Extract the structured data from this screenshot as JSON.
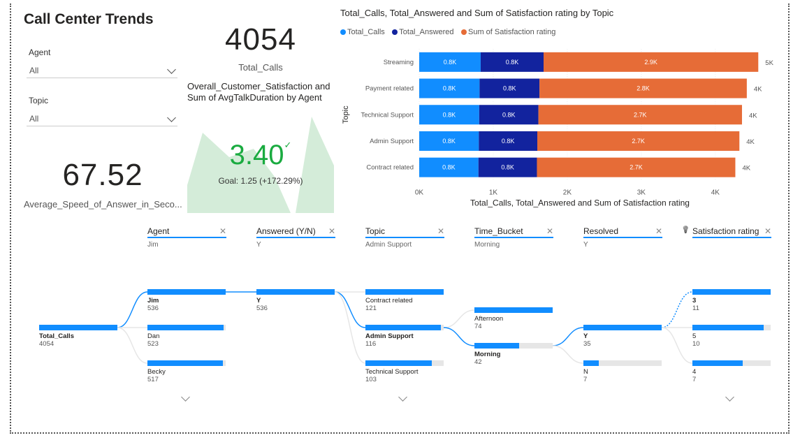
{
  "title": "Call Center Trends",
  "slicers": [
    {
      "label": "Agent",
      "value": "All"
    },
    {
      "label": "Topic",
      "value": "All"
    }
  ],
  "total_calls_card": {
    "value": "4054",
    "label": "Total_Calls"
  },
  "asa_card": {
    "value": "67.52",
    "label": "Average_Speed_of_Answer_in_Seco..."
  },
  "kpi": {
    "title": "Overall_Customer_Satisfaction and Sum of AvgTalkDuration by Agent",
    "value": "3.40",
    "goal": "Goal: 1.25 (+172.29%)",
    "trend_level": 1.0
  },
  "colors": {
    "total_calls": "#118DFF",
    "total_answered": "#12239E",
    "satisfaction": "#E66C37",
    "kpi_green": "#1AAB40",
    "kpi_area": "#d4ecd9"
  },
  "chart_data": {
    "type": "bar",
    "title": "Total_Calls, Total_Answered and Sum of Satisfaction rating by Topic",
    "xlabel": "Total_Calls, Total_Answered and Sum of Satisfaction rating",
    "ylabel": "Topic",
    "categories": [
      "Streaming",
      "Payment related",
      "Technical Support",
      "Admin Support",
      "Contract related"
    ],
    "series": [
      {
        "name": "Total_Calls",
        "values": [
          830,
          815,
          810,
          805,
          800
        ],
        "labels": [
          "0.8K",
          "0.8K",
          "0.8K",
          "0.8K",
          "0.8K"
        ]
      },
      {
        "name": "Total_Answered",
        "values": [
          850,
          810,
          800,
          790,
          790
        ],
        "labels": [
          "0.8K",
          "0.8K",
          "0.8K",
          "0.8K",
          "0.8K"
        ]
      },
      {
        "name": "Sum of Satisfaction rating",
        "values": [
          2900,
          2800,
          2750,
          2730,
          2680
        ],
        "labels": [
          "2.9K",
          "2.8K",
          "2.7K",
          "2.7K",
          "2.7K"
        ]
      }
    ],
    "totals": [
      "5K",
      "4K",
      "4K",
      "4K",
      "4K"
    ],
    "xticks": [
      "0K",
      "1K",
      "2K",
      "3K",
      "4K"
    ],
    "xlim": [
      0,
      4700
    ],
    "stacked": true
  },
  "decomp": {
    "levels": [
      {
        "title": "Agent",
        "value": "Jim"
      },
      {
        "title": "Answered (Y/N)",
        "value": "Y"
      },
      {
        "title": "Topic",
        "value": "Admin Support"
      },
      {
        "title": "Time_Bucket",
        "value": "Morning"
      },
      {
        "title": "Resolved",
        "value": "Y"
      },
      {
        "title": "Satisfaction rating",
        "value": ""
      }
    ],
    "root": {
      "label": "Total_Calls",
      "value": "4054",
      "fill": 1.0
    },
    "agent": [
      {
        "label": "Jim",
        "value": "536",
        "fill": 1.0
      },
      {
        "label": "Dan",
        "value": "523",
        "fill": 0.976
      },
      {
        "label": "Becky",
        "value": "517",
        "fill": 0.965
      }
    ],
    "answered": [
      {
        "label": "Y",
        "value": "536",
        "fill": 1.0
      }
    ],
    "topic": [
      {
        "label": "Contract related",
        "value": "121",
        "fill": 1.0
      },
      {
        "label": "Admin Support",
        "value": "116",
        "fill": 0.96
      },
      {
        "label": "Technical Support",
        "value": "103",
        "fill": 0.85
      }
    ],
    "time": [
      {
        "label": "Afternoon",
        "value": "74",
        "fill": 1.0
      },
      {
        "label": "Morning",
        "value": "42",
        "fill": 0.57
      }
    ],
    "resolved": [
      {
        "label": "Y",
        "value": "35",
        "fill": 1.0
      },
      {
        "label": "N",
        "value": "7",
        "fill": 0.2
      }
    ],
    "satisfaction": [
      {
        "label": "3",
        "value": "11",
        "fill": 1.0
      },
      {
        "label": "5",
        "value": "10",
        "fill": 0.91
      },
      {
        "label": "4",
        "value": "7",
        "fill": 0.64
      }
    ]
  }
}
